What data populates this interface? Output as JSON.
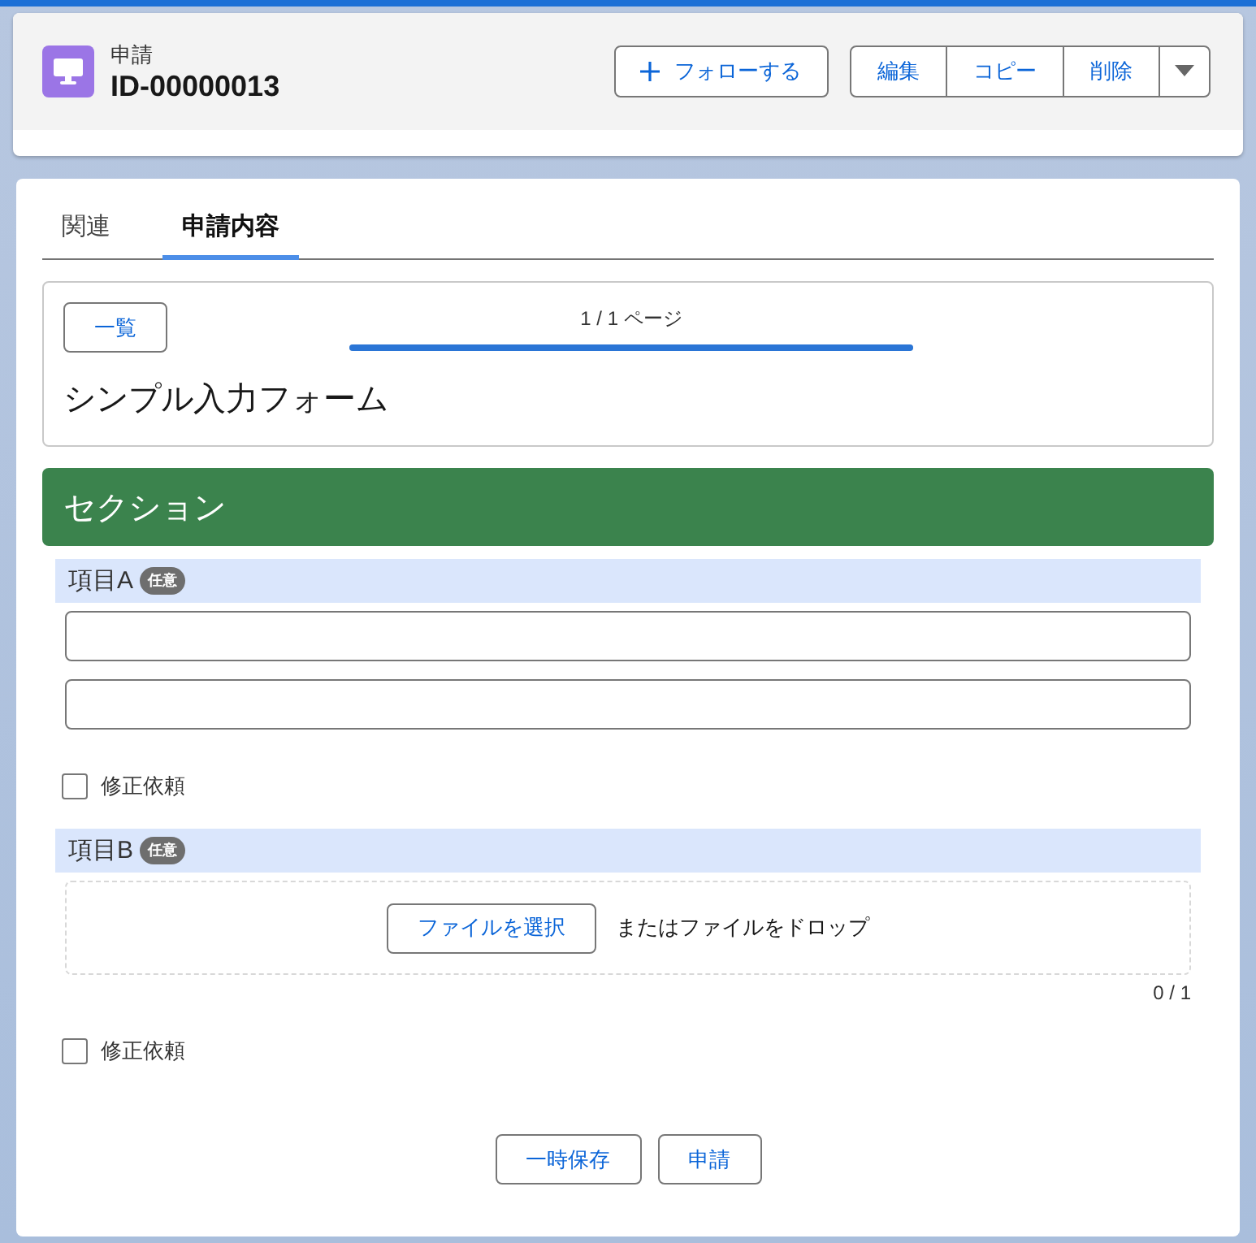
{
  "record": {
    "object_label": "申請",
    "id": "ID-00000013"
  },
  "header_actions": {
    "follow_button": "フォローする",
    "button_group": [
      "編集",
      "コピー",
      "削除"
    ]
  },
  "tabs": [
    {
      "label": "関連",
      "selected": false
    },
    {
      "label": "申請内容",
      "selected": true
    }
  ],
  "form": {
    "list_button": "一覧",
    "page_indicator": "1 / 1 ページ",
    "progress": {
      "level": 1
    },
    "title": "シンプル入力フォーム",
    "section": "セクション",
    "fields": [
      {
        "kind": "text",
        "label": "項目A",
        "badge": "任意",
        "inputs": [
          {
            "kind": "text"
          },
          {
            "kind": "text"
          }
        ],
        "checkbox": {
          "label": "修正依頼",
          "checked": false
        }
      },
      {
        "kind": "file",
        "label": "項目B",
        "badge": "任意",
        "file_button": "ファイルを選択",
        "drop_text": "またはファイルをドロップ",
        "count": "0 / 1",
        "checkbox": {
          "label": "修正依頼",
          "checked": false
        }
      }
    ],
    "buttons": [
      "一時保存",
      "申請"
    ]
  }
}
